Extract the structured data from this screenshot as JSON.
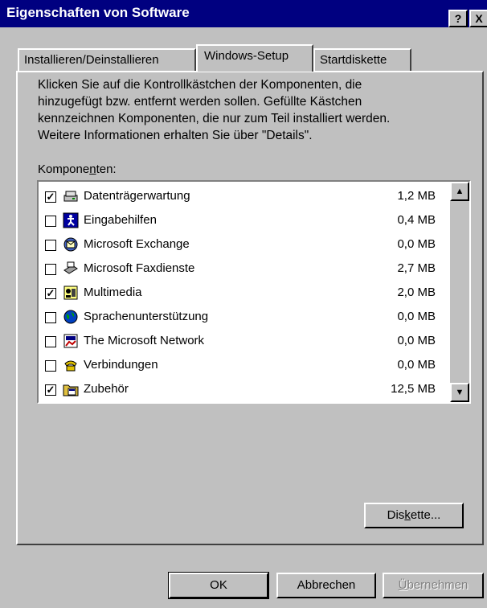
{
  "window": {
    "title": "Eigenschaften von Software",
    "help_button": "?",
    "close_button": "X"
  },
  "tabs": [
    {
      "label": "Installieren/Deinstallieren",
      "active": false
    },
    {
      "label": "Windows-Setup",
      "active": true
    },
    {
      "label": "Startdiskette",
      "active": false
    }
  ],
  "description": {
    "line1": "Klicken Sie auf die Kontrollkästchen der Komponenten, die",
    "line2": "hinzugefügt bzw. entfernt werden sollen. Gefüllte Kästchen",
    "line3": "kennzeichnen Komponenten, die nur zum Teil installiert werden.",
    "line4": "Weitere Informationen erhalten Sie über \"Details\"."
  },
  "components_label": {
    "before": "Kompone",
    "accel": "n",
    "after": "ten:"
  },
  "components": [
    {
      "name": "Datenträgerwartung",
      "size": "1,2 MB",
      "checked": true,
      "icon": "disk-maintenance-icon"
    },
    {
      "name": "Eingabehilfen",
      "size": "0,4 MB",
      "checked": false,
      "icon": "accessibility-icon"
    },
    {
      "name": "Microsoft Exchange",
      "size": "0,0 MB",
      "checked": false,
      "icon": "exchange-icon"
    },
    {
      "name": "Microsoft Faxdienste",
      "size": "2,7 MB",
      "checked": false,
      "icon": "fax-icon"
    },
    {
      "name": "Multimedia",
      "size": "2,0 MB",
      "checked": true,
      "icon": "multimedia-icon"
    },
    {
      "name": "Sprachenunterstützung",
      "size": "0,0 MB",
      "checked": false,
      "icon": "globe-icon"
    },
    {
      "name": "The Microsoft Network",
      "size": "0,0 MB",
      "checked": false,
      "icon": "msn-icon"
    },
    {
      "name": "Verbindungen",
      "size": "0,0 MB",
      "checked": false,
      "icon": "phone-icon"
    },
    {
      "name": "Zubehör",
      "size": "12,5 MB",
      "checked": true,
      "icon": "accessories-icon"
    }
  ],
  "scrollbar": {
    "up": "▲",
    "down": "▼"
  },
  "buttons": {
    "diskette": {
      "before": "Dis",
      "accel": "k",
      "after": "ette..."
    },
    "ok": "OK",
    "cancel": "Abbrechen",
    "apply": {
      "accel": "Ü",
      "after": "bernehmen"
    }
  },
  "colors": {
    "titlebar": "#000080",
    "face": "#c0c0c0"
  }
}
